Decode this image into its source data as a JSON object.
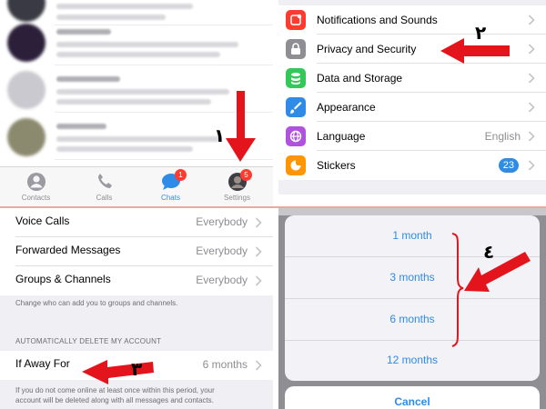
{
  "chats_screen": {
    "tabs": [
      {
        "label": "Contacts",
        "icon": "person-circle-icon"
      },
      {
        "label": "Calls",
        "icon": "phone-icon"
      },
      {
        "label": "Chats",
        "icon": "chat-bubbles-icon",
        "badge": "1",
        "active": true
      },
      {
        "label": "Settings",
        "icon": "avatar-icon",
        "badge": "5"
      }
    ]
  },
  "settings_screen": {
    "rows": [
      {
        "label": "Notifications and Sounds",
        "icon": "bell-icon",
        "color": "#ff3b30"
      },
      {
        "label": "Privacy and Security",
        "icon": "lock-icon",
        "color": "#8e8e93"
      },
      {
        "label": "Data and Storage",
        "icon": "database-icon",
        "color": "#34c759"
      },
      {
        "label": "Appearance",
        "icon": "brush-icon",
        "color": "#2f8ce6"
      },
      {
        "label": "Language",
        "value": "English",
        "icon": "globe-icon",
        "color": "#af52de"
      },
      {
        "label": "Stickers",
        "count": "23",
        "icon": "sticker-icon",
        "color": "#ff9500"
      }
    ]
  },
  "privacy_screen": {
    "rows": [
      {
        "label": "Voice Calls",
        "value": "Everybody"
      },
      {
        "label": "Forwarded Messages",
        "value": "Everybody"
      },
      {
        "label": "Groups & Channels",
        "value": "Everybody"
      }
    ],
    "groups_note": "Change who can add you to groups and channels.",
    "section_header": "AUTOMATICALLY DELETE MY ACCOUNT",
    "away_row": {
      "label": "If Away For",
      "value": "6 months"
    },
    "away_note_line1": "If you do not come online at least once within this period, your",
    "away_note_line2": "account will be deleted along with all messages and contacts."
  },
  "duration_sheet": {
    "options": [
      "1 month",
      "3 months",
      "6 months",
      "12 months"
    ],
    "cancel": "Cancel"
  },
  "annotations": {
    "step1": "١",
    "step2": "٢",
    "step3": "٣",
    "step4": "٤",
    "arrow_color": "#e3141b"
  }
}
